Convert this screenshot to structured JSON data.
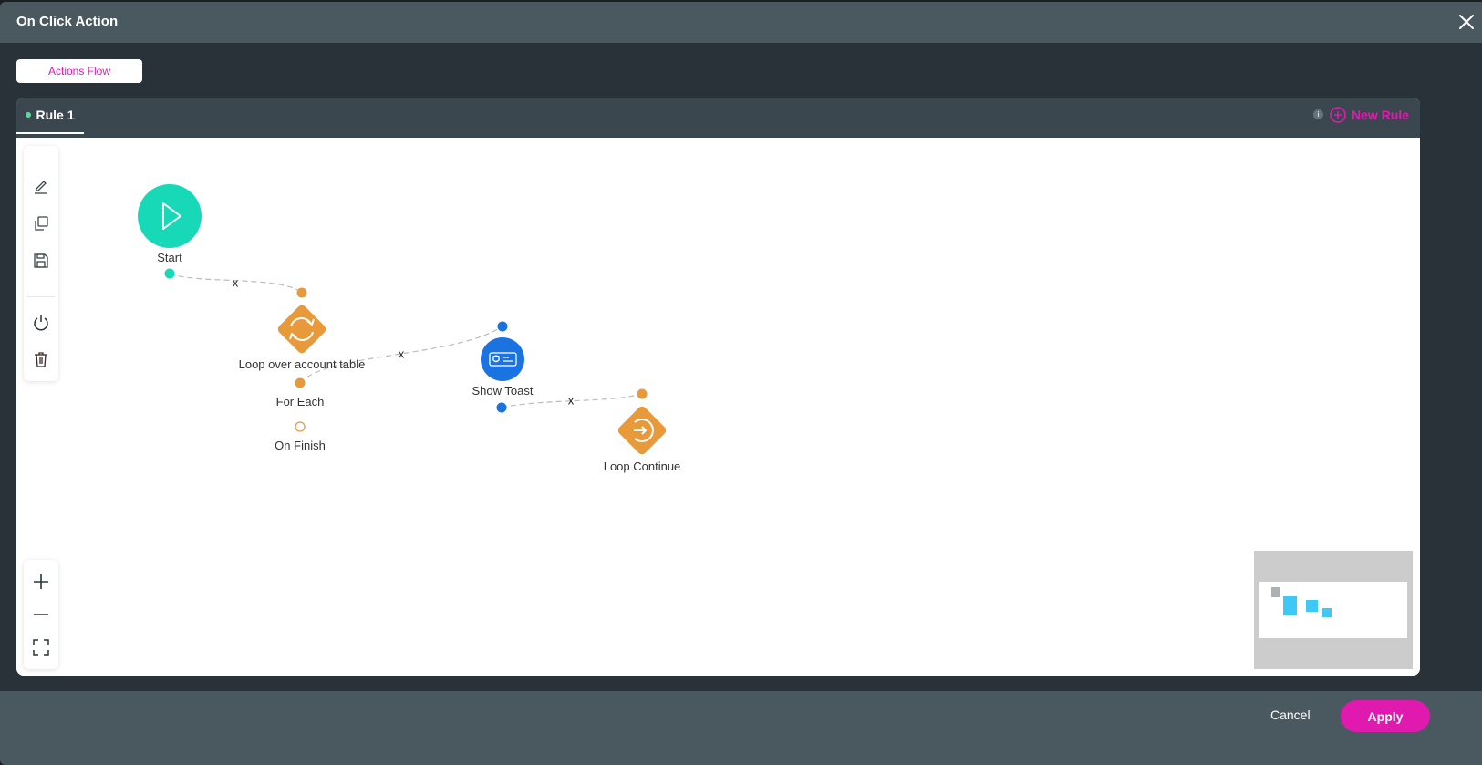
{
  "dialog": {
    "title": "On Click Action",
    "close_icon": "close-icon"
  },
  "tabs": {
    "actions_flow": "Actions Flow"
  },
  "rules": {
    "active_rule": "Rule 1",
    "new_rule_label": "New Rule",
    "info_icon_glyph": "i"
  },
  "toolbar": {
    "items": [
      "edit-icon",
      "copy-icon",
      "save-icon",
      "power-icon",
      "trash-icon"
    ]
  },
  "zoom_controls": {
    "items": [
      "zoom-in-icon",
      "zoom-out-icon",
      "fit-view-icon"
    ]
  },
  "flow": {
    "nodes": [
      {
        "id": "start",
        "label": "Start",
        "type": "start",
        "color": "#17d9b8"
      },
      {
        "id": "loop",
        "label": "Loop over account table",
        "type": "loop",
        "color": "#e8993a"
      },
      {
        "id": "toast",
        "label": "Show Toast",
        "type": "toast",
        "color": "#1a73e0"
      },
      {
        "id": "continue",
        "label": "Loop Continue",
        "type": "loop-continue",
        "color": "#e8993a"
      }
    ],
    "ports": {
      "for_each": "For Each",
      "on_finish": "On Finish"
    },
    "connection_remove_label": "x"
  },
  "footer": {
    "cancel": "Cancel",
    "apply": "Apply"
  },
  "colors": {
    "accent": "#e01aae",
    "start": "#17d9b8",
    "loop": "#e8993a",
    "toast": "#1a73e0"
  }
}
